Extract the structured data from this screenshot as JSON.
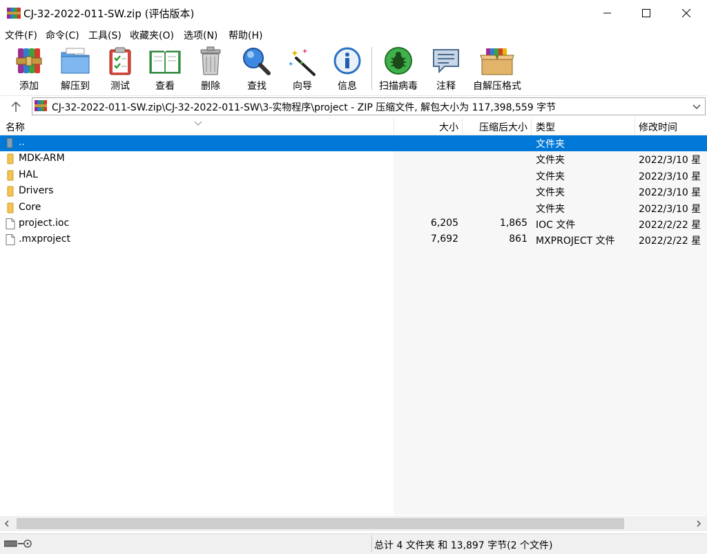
{
  "window": {
    "title": "CJ-32-2022-011-SW.zip (评估版本)"
  },
  "menu": {
    "items": [
      "文件(F)",
      "命令(C)",
      "工具(S)",
      "收藏夹(O)",
      "选项(N)",
      "帮助(H)"
    ]
  },
  "toolbar": {
    "add": "添加",
    "extract_to": "解压到",
    "test": "测试",
    "view": "查看",
    "delete": "删除",
    "find": "查找",
    "wizard": "向导",
    "info": "信息",
    "virus_scan": "扫描病毒",
    "comment": "注释",
    "sfx": "自解压格式"
  },
  "address": {
    "path": "CJ-32-2022-011-SW.zip\\CJ-32-2022-011-SW\\3-实物程序\\project - ZIP 压缩文件, 解包大小为 117,398,559 字节"
  },
  "columns": {
    "name": "名称",
    "size": "大小",
    "packed": "压缩后大小",
    "type": "类型",
    "modified": "修改时间"
  },
  "files": [
    {
      "name": "..",
      "size": "",
      "packed": "",
      "type": "文件夹",
      "modified": "",
      "kind": "parent"
    },
    {
      "name": "MDK-ARM",
      "size": "",
      "packed": "",
      "type": "文件夹",
      "modified": "2022/3/10 星",
      "kind": "folder"
    },
    {
      "name": "HAL",
      "size": "",
      "packed": "",
      "type": "文件夹",
      "modified": "2022/3/10 星",
      "kind": "folder"
    },
    {
      "name": "Drivers",
      "size": "",
      "packed": "",
      "type": "文件夹",
      "modified": "2022/3/10 星",
      "kind": "folder"
    },
    {
      "name": "Core",
      "size": "",
      "packed": "",
      "type": "文件夹",
      "modified": "2022/3/10 星",
      "kind": "folder"
    },
    {
      "name": "project.ioc",
      "size": "6,205",
      "packed": "1,865",
      "type": "IOC 文件",
      "modified": "2022/2/22 星",
      "kind": "file"
    },
    {
      "name": ".mxproject",
      "size": "7,692",
      "packed": "861",
      "type": "MXPROJECT 文件",
      "modified": "2022/2/22 星",
      "kind": "file"
    }
  ],
  "status": {
    "summary": "总计 4 文件夹 和 13,897 字节(2 个文件)"
  },
  "colors": {
    "selection": "#0078d7",
    "folder": "#f5c451"
  }
}
